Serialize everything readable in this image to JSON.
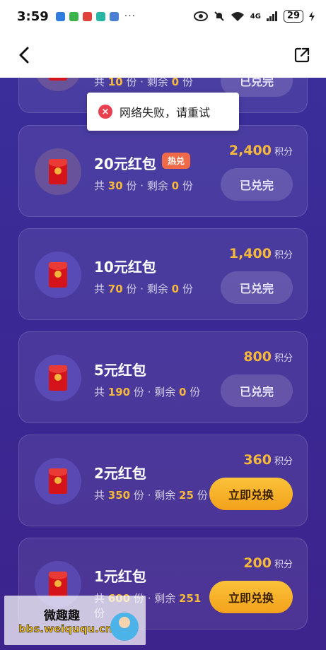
{
  "status_bar": {
    "time": "3:59",
    "more": "···",
    "network": "4G",
    "battery": "29"
  },
  "toast": {
    "text": "网络失败，请重试",
    "icon": "close-circle-icon"
  },
  "labels": {
    "total_prefix": "共",
    "unit": "份",
    "separator": "·",
    "remain_prefix": "剩余",
    "points_unit": "积分",
    "hot_badge": "热兑"
  },
  "items": [
    {
      "name": "",
      "total": "10",
      "remain": "0",
      "price": "",
      "button": "已兑完",
      "state": "done"
    },
    {
      "name": "20元红包",
      "total": "30",
      "remain": "0",
      "price": "2,400",
      "button": "已兑完",
      "state": "done",
      "hot": true
    },
    {
      "name": "10元红包",
      "total": "70",
      "remain": "0",
      "price": "1,400",
      "button": "已兑完",
      "state": "done"
    },
    {
      "name": "5元红包",
      "total": "190",
      "remain": "0",
      "price": "800",
      "button": "已兑完",
      "state": "done"
    },
    {
      "name": "2元红包",
      "total": "350",
      "remain": "25",
      "price": "360",
      "button": "立即兑换",
      "state": "available"
    },
    {
      "name": "1元红包",
      "total": "600",
      "remain": "251",
      "price": "200",
      "button": "立即兑换",
      "state": "available"
    }
  ],
  "watermark": {
    "title": "微趣趣",
    "url": "bbs.weiququ.cn"
  },
  "colors": {
    "accent": "#f5b83a",
    "button_gold": "#f3a11b",
    "bg": "#3b2f9c",
    "hot": "#f06a4a"
  }
}
